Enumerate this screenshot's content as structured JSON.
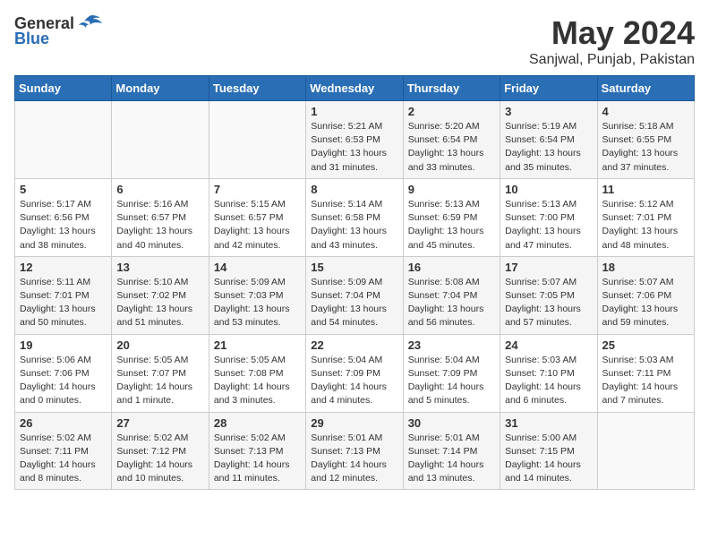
{
  "header": {
    "logo_general": "General",
    "logo_blue": "Blue",
    "month_title": "May 2024",
    "location": "Sanjwal, Punjab, Pakistan"
  },
  "calendar": {
    "headers": [
      "Sunday",
      "Monday",
      "Tuesday",
      "Wednesday",
      "Thursday",
      "Friday",
      "Saturday"
    ],
    "weeks": [
      [
        {
          "day": "",
          "info": ""
        },
        {
          "day": "",
          "info": ""
        },
        {
          "day": "",
          "info": ""
        },
        {
          "day": "1",
          "info": "Sunrise: 5:21 AM\nSunset: 6:53 PM\nDaylight: 13 hours\nand 31 minutes."
        },
        {
          "day": "2",
          "info": "Sunrise: 5:20 AM\nSunset: 6:54 PM\nDaylight: 13 hours\nand 33 minutes."
        },
        {
          "day": "3",
          "info": "Sunrise: 5:19 AM\nSunset: 6:54 PM\nDaylight: 13 hours\nand 35 minutes."
        },
        {
          "day": "4",
          "info": "Sunrise: 5:18 AM\nSunset: 6:55 PM\nDaylight: 13 hours\nand 37 minutes."
        }
      ],
      [
        {
          "day": "5",
          "info": "Sunrise: 5:17 AM\nSunset: 6:56 PM\nDaylight: 13 hours\nand 38 minutes."
        },
        {
          "day": "6",
          "info": "Sunrise: 5:16 AM\nSunset: 6:57 PM\nDaylight: 13 hours\nand 40 minutes."
        },
        {
          "day": "7",
          "info": "Sunrise: 5:15 AM\nSunset: 6:57 PM\nDaylight: 13 hours\nand 42 minutes."
        },
        {
          "day": "8",
          "info": "Sunrise: 5:14 AM\nSunset: 6:58 PM\nDaylight: 13 hours\nand 43 minutes."
        },
        {
          "day": "9",
          "info": "Sunrise: 5:13 AM\nSunset: 6:59 PM\nDaylight: 13 hours\nand 45 minutes."
        },
        {
          "day": "10",
          "info": "Sunrise: 5:13 AM\nSunset: 7:00 PM\nDaylight: 13 hours\nand 47 minutes."
        },
        {
          "day": "11",
          "info": "Sunrise: 5:12 AM\nSunset: 7:01 PM\nDaylight: 13 hours\nand 48 minutes."
        }
      ],
      [
        {
          "day": "12",
          "info": "Sunrise: 5:11 AM\nSunset: 7:01 PM\nDaylight: 13 hours\nand 50 minutes."
        },
        {
          "day": "13",
          "info": "Sunrise: 5:10 AM\nSunset: 7:02 PM\nDaylight: 13 hours\nand 51 minutes."
        },
        {
          "day": "14",
          "info": "Sunrise: 5:09 AM\nSunset: 7:03 PM\nDaylight: 13 hours\nand 53 minutes."
        },
        {
          "day": "15",
          "info": "Sunrise: 5:09 AM\nSunset: 7:04 PM\nDaylight: 13 hours\nand 54 minutes."
        },
        {
          "day": "16",
          "info": "Sunrise: 5:08 AM\nSunset: 7:04 PM\nDaylight: 13 hours\nand 56 minutes."
        },
        {
          "day": "17",
          "info": "Sunrise: 5:07 AM\nSunset: 7:05 PM\nDaylight: 13 hours\nand 57 minutes."
        },
        {
          "day": "18",
          "info": "Sunrise: 5:07 AM\nSunset: 7:06 PM\nDaylight: 13 hours\nand 59 minutes."
        }
      ],
      [
        {
          "day": "19",
          "info": "Sunrise: 5:06 AM\nSunset: 7:06 PM\nDaylight: 14 hours\nand 0 minutes."
        },
        {
          "day": "20",
          "info": "Sunrise: 5:05 AM\nSunset: 7:07 PM\nDaylight: 14 hours\nand 1 minute."
        },
        {
          "day": "21",
          "info": "Sunrise: 5:05 AM\nSunset: 7:08 PM\nDaylight: 14 hours\nand 3 minutes."
        },
        {
          "day": "22",
          "info": "Sunrise: 5:04 AM\nSunset: 7:09 PM\nDaylight: 14 hours\nand 4 minutes."
        },
        {
          "day": "23",
          "info": "Sunrise: 5:04 AM\nSunset: 7:09 PM\nDaylight: 14 hours\nand 5 minutes."
        },
        {
          "day": "24",
          "info": "Sunrise: 5:03 AM\nSunset: 7:10 PM\nDaylight: 14 hours\nand 6 minutes."
        },
        {
          "day": "25",
          "info": "Sunrise: 5:03 AM\nSunset: 7:11 PM\nDaylight: 14 hours\nand 7 minutes."
        }
      ],
      [
        {
          "day": "26",
          "info": "Sunrise: 5:02 AM\nSunset: 7:11 PM\nDaylight: 14 hours\nand 8 minutes."
        },
        {
          "day": "27",
          "info": "Sunrise: 5:02 AM\nSunset: 7:12 PM\nDaylight: 14 hours\nand 10 minutes."
        },
        {
          "day": "28",
          "info": "Sunrise: 5:02 AM\nSunset: 7:13 PM\nDaylight: 14 hours\nand 11 minutes."
        },
        {
          "day": "29",
          "info": "Sunrise: 5:01 AM\nSunset: 7:13 PM\nDaylight: 14 hours\nand 12 minutes."
        },
        {
          "day": "30",
          "info": "Sunrise: 5:01 AM\nSunset: 7:14 PM\nDaylight: 14 hours\nand 13 minutes."
        },
        {
          "day": "31",
          "info": "Sunrise: 5:00 AM\nSunset: 7:15 PM\nDaylight: 14 hours\nand 14 minutes."
        },
        {
          "day": "",
          "info": ""
        }
      ]
    ]
  }
}
